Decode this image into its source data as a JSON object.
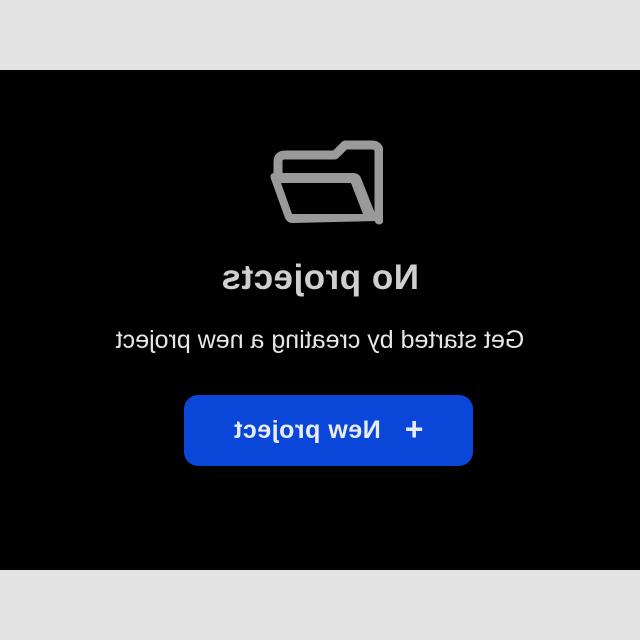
{
  "empty_state": {
    "icon": "folder-open-icon",
    "title": "No projects",
    "subtitle": "Get started by creating a new project"
  },
  "actions": {
    "new_project": {
      "icon": "plus-icon",
      "icon_glyph": "+",
      "label": "New project"
    }
  },
  "colors": {
    "panel_background": "#000000",
    "frame_background": "#e3e3e3",
    "accent": "#0a47d8",
    "title_text": "#cfcfcf",
    "body_text": "#e6e6e6",
    "icon": "#9a9a9a"
  }
}
